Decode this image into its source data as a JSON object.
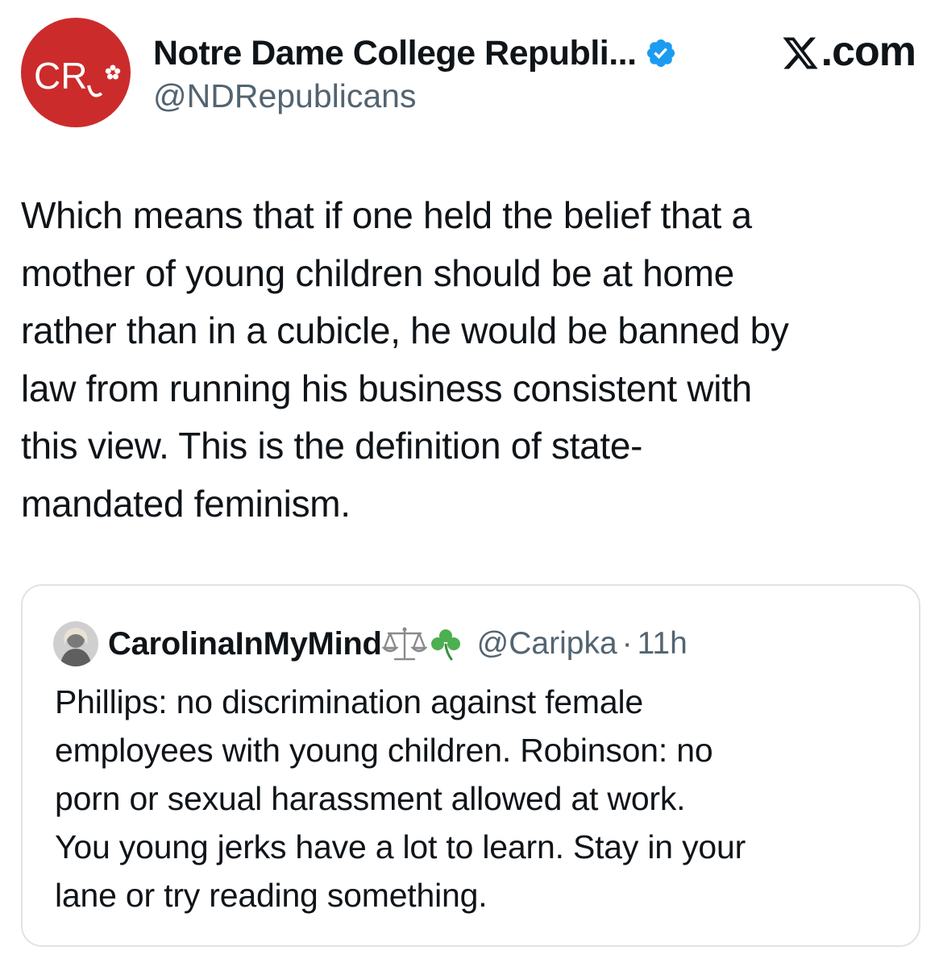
{
  "author": {
    "avatar_text": "CR",
    "display_name": "Notre Dame College Republi...",
    "handle": "@NDRepublicans",
    "verified_icon": "verified-badge-icon",
    "verified_color": "#1d9bf0",
    "avatar_color": "#cc2b2b"
  },
  "site": {
    "label": ".com",
    "logo_icon": "x-logo-icon"
  },
  "tweet": {
    "lines": [
      "Which means that if one held the belief that a",
      "mother of young children should be at home",
      "rather than in a cubicle, he would be banned by",
      "law from running his business consistent with",
      "this view. This is the definition of state-",
      "mandated feminism."
    ]
  },
  "quoted": {
    "display_name": "CarolinaInMyMind",
    "emoji_icons": [
      "scales-icon",
      "shamrock-icon"
    ],
    "handle": "@Caripka",
    "separator": "·",
    "time": "11h",
    "lines": [
      "Phillips: no discrimination against female",
      "employees with young children. Robinson: no",
      "porn or sexual harassment allowed at work.",
      "You young jerks have a lot to learn. Stay in your",
      "lane or try reading something."
    ]
  }
}
